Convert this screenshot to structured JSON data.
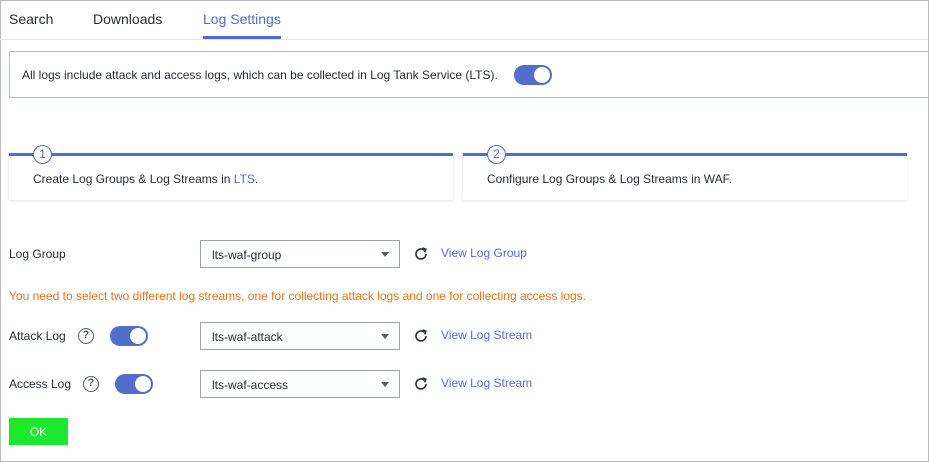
{
  "tabs": [
    {
      "label": "Search"
    },
    {
      "label": "Downloads"
    },
    {
      "label": "Log Settings",
      "active": true
    }
  ],
  "info": {
    "text": "All logs include attack and access logs, which can be collected in Log Tank Service (LTS).",
    "toggle_on": true
  },
  "steps": [
    {
      "number": "1",
      "text_before": "Create Log Groups & Log Streams in ",
      "link": "LTS",
      "text_after": "."
    },
    {
      "number": "2",
      "text": "Configure Log Groups & Log Streams in WAF."
    }
  ],
  "log_group": {
    "label": "Log Group",
    "value": "lts-waf-group",
    "link": "View Log Group"
  },
  "warning": "You need to select two different log streams, one for collecting attack logs and one for collecting access logs.",
  "attack_log": {
    "label": "Attack Log",
    "help": "?",
    "toggle_on": true,
    "value": "lts-waf-attack",
    "link": "View Log Stream"
  },
  "access_log": {
    "label": "Access Log",
    "help": "?",
    "toggle_on": true,
    "value": "lts-waf-access",
    "link": "View Log Stream"
  },
  "ok_label": "OK",
  "colors": {
    "accent": "#526ecc",
    "warning": "#e87218",
    "ok_button": "#1ce82d"
  }
}
